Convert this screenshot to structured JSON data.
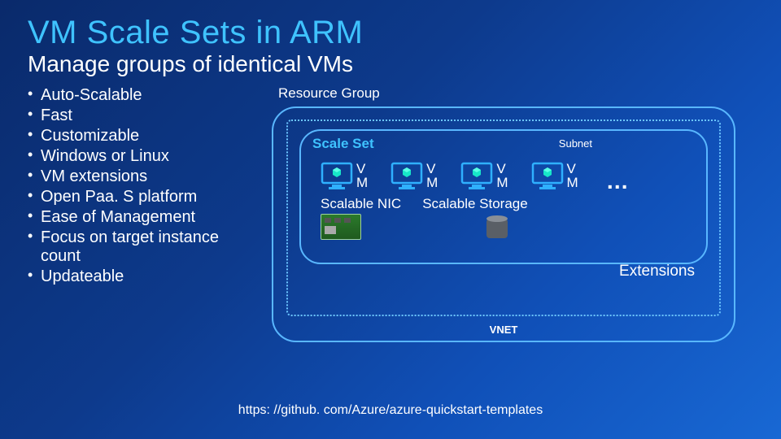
{
  "title": "VM Scale Sets in ARM",
  "subtitle": "Manage groups of identical VMs",
  "bullets": [
    "Auto-Scalable",
    "Fast",
    "Customizable",
    "Windows or Linux",
    "VM extensions",
    "Open Paa. S platform",
    "Ease of Management",
    "Focus on target instance count",
    "Updateable"
  ],
  "diagram": {
    "resource_group_label": "Resource Group",
    "scale_set_label": "Scale Set",
    "subnet_label": "Subnet",
    "vm_label": "V\nM",
    "vm_count": 4,
    "ellipsis": "…",
    "scalable_nic_label": "Scalable NIC",
    "scalable_storage_label": "Scalable Storage",
    "extensions_label": "Extensions",
    "vnet_label": "VNET"
  },
  "footer_url": "https: //github. com/Azure/azure-quickstart-templates"
}
